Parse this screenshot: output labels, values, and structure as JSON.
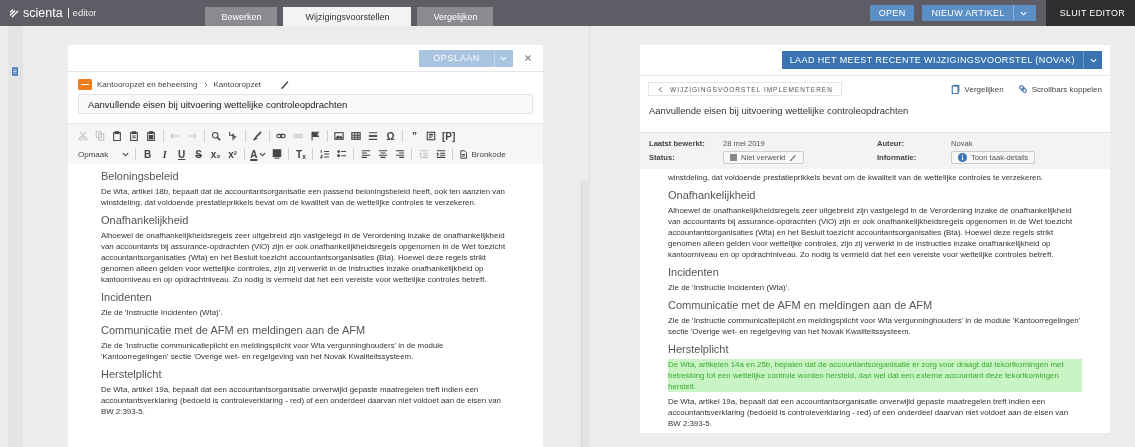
{
  "app": {
    "logo": "scienta",
    "product": "editor"
  },
  "tabs": [
    {
      "label": "Bewerken",
      "selected": false
    },
    {
      "label": "Wijzigingsvoorstellen",
      "selected": true
    },
    {
      "label": "Vergelijken",
      "selected": false
    }
  ],
  "top_actions": {
    "open": "OPEN",
    "new_article": "NIEUW ARTIKEL",
    "close_editor": "SLUIT EDITOR"
  },
  "editor": {
    "save": "OPSLAAN",
    "breadcrumb": [
      "Kantooropzet en beheersing",
      "Kantooropzet"
    ],
    "title": "Aanvullende eisen bij uitvoering wettelijke controleopdrachten",
    "toolbar": [
      [
        {
          "kind": "icon",
          "disabled": true
        },
        {
          "kind": "icon",
          "disabled": true
        },
        {
          "kind": "icon",
          "disabled": false
        },
        {
          "kind": "icon",
          "disabled": false
        },
        {
          "kind": "icon",
          "disabled": false
        },
        {
          "kind": "sep"
        },
        {
          "kind": "icon",
          "disabled": true
        },
        {
          "kind": "icon",
          "disabled": true
        },
        {
          "kind": "sep"
        },
        {
          "kind": "icon",
          "disabled": false
        },
        {
          "kind": "icon",
          "disabled": false
        },
        {
          "kind": "sep"
        },
        {
          "kind": "icon",
          "disabled": false
        },
        {
          "kind": "sep"
        },
        {
          "kind": "icon",
          "disabled": false
        },
        {
          "kind": "icon",
          "disabled": true
        },
        {
          "kind": "icon",
          "disabled": false
        },
        {
          "kind": "sep"
        },
        {
          "kind": "icon",
          "disabled": false
        },
        {
          "kind": "icon",
          "disabled": false
        },
        {
          "kind": "icon",
          "disabled": false
        },
        {
          "kind": "glyph",
          "text": "Ω",
          "disabled": false
        },
        {
          "kind": "sep"
        },
        {
          "kind": "glyph",
          "text": "”",
          "disabled": false
        },
        {
          "kind": "icon",
          "disabled": false
        },
        {
          "kind": "glyph",
          "text": "[P]",
          "disabled": false
        }
      ],
      [
        {
          "kind": "dropdown",
          "text": "Opmaak"
        },
        {
          "kind": "sep"
        },
        {
          "kind": "bold",
          "text": "B"
        },
        {
          "kind": "italic",
          "text": "I"
        },
        {
          "kind": "underline",
          "text": "U"
        },
        {
          "kind": "strike",
          "text": "S"
        },
        {
          "kind": "glyph",
          "text": "x₂",
          "disabled": false
        },
        {
          "kind": "glyph",
          "text": "x²",
          "disabled": false
        },
        {
          "kind": "sep"
        },
        {
          "kind": "color",
          "text": "A"
        },
        {
          "kind": "icon",
          "disabled": false
        },
        {
          "kind": "sep"
        },
        {
          "kind": "glyph",
          "text": "Tₓ",
          "disabled": false
        },
        {
          "kind": "sep"
        },
        {
          "kind": "icon",
          "disabled": false
        },
        {
          "kind": "icon",
          "disabled": false
        },
        {
          "kind": "sep"
        },
        {
          "kind": "icon",
          "disabled": false
        },
        {
          "kind": "icon",
          "disabled": false
        },
        {
          "kind": "icon",
          "disabled": false
        },
        {
          "kind": "sep"
        },
        {
          "kind": "icon",
          "disabled": true
        },
        {
          "kind": "icon",
          "disabled": false
        },
        {
          "kind": "sep"
        },
        {
          "kind": "source",
          "text": "Bronkode"
        }
      ]
    ],
    "content": [
      {
        "kind": "heading",
        "text": "Beloningsbeleid"
      },
      {
        "kind": "paragraph",
        "text": "De Wta, artikel 18b, bepaalt dat de accountantsorganisatie een passend beloningsbeleid heeft, ook ten aanzien van winstdeling, dat voldoende prestatieprikkels bevat om de kwaliteit van de wettelijke controles te verzekeren."
      },
      {
        "kind": "heading",
        "text": "Onafhankelijkheid"
      },
      {
        "kind": "paragraph",
        "text": "Alhoewel de onafhankelijkheidsregels zeer uitgebreid zijn vastgelegd in de Verordening inzake de onafhankelijkheid van accountants bij assurance-opdrachten (ViO) zijn er ook onafhankelijkheidsregels opgenomen in de Wet toezicht accountantsorganisaties (Wta) en het Besluit toezicht accountantsorganisaties (Bta). Hoewel deze regels strikt genomen alleen gelden voor wettelijke controles, zijn zij verwerkt in de instructies inzake onafhankelijkheid op kantoorniveau en op opdrachtniveau. Zo nodig is vermeld dat het een vereiste voor wettelijke controles betreft."
      },
      {
        "kind": "heading",
        "text": "Incidenten"
      },
      {
        "kind": "paragraph",
        "text": "Zie de 'Instructie Incidenten (Wta)'."
      },
      {
        "kind": "heading",
        "text": "Communicatie met de AFM en meldingen aan de AFM"
      },
      {
        "kind": "paragraph",
        "text": "Zie de 'Instructie communicatieplicht en meldingsplicht voor Wta vergunninghouders' in de module 'Kantoorregelingen' sectie 'Overige wet- en regelgeving van het Novak Kwaliteitssysteem."
      },
      {
        "kind": "heading",
        "text": "Herstelplicht"
      },
      {
        "kind": "paragraph",
        "text": "De Wta, artikel 19a, bepaalt dat een accountantsorganisatie onverwijld gepaste maatregelen treft indien een accountantsverklaring (bedoeld is controleverklaring - red) of een onderdeel daarvan niet voldoet aan de eisen van BW 2:393-5."
      }
    ]
  },
  "proposal": {
    "load": "LAAD HET MEEST RECENTE WIJZIGINGSVOORSTEL (NOVAK)",
    "back": "WIJZIGINGSVOORSTEL IMPLEMENTEREN",
    "links": [
      "Vergelijken",
      "Scrollbars koppelen"
    ],
    "title": "Aanvullende eisen bij uitvoering wettelijke controleopdrachten",
    "meta": {
      "last_edited_label": "Laatst bewerkt:",
      "last_edited": "28 mei 2019",
      "author_label": "Auteur:",
      "author": "Novak",
      "status_label": "Status:",
      "status": "Niet verwerkt",
      "info_label": "Informatie:",
      "info_button": "Toon taak-details"
    },
    "content": [
      {
        "kind": "paragraph",
        "text": "winstdeling, dat voldoende prestatieprikkels bevat om de kwaliteit van de wettelijke controles te verzekeren."
      },
      {
        "kind": "heading",
        "text": "Onafhankelijkheid"
      },
      {
        "kind": "paragraph",
        "text": "Alhoewel de onafhankelijkheidsregels zeer uitgebreid zijn vastgelegd in de Verordening inzake de onafhankelijkheid van accountants bij assurance-opdrachten (ViO) zijn er ook onafhankelijkheidsregels opgenomen in de Wet toezicht accountantsorganisaties (Wta) en het Besluit toezicht accountantsorganisaties (Bta). Hoewel deze regels strikt genomen alleen gelden voor wettelijke controles, zijn zij verwerkt in de instructies inzake onafhankelijkheid op kantoorniveau en op opdrachtniveau. Zo nodig is vermeld dat het een vereiste voor wettelijke controles betreft."
      },
      {
        "kind": "heading",
        "text": "Incidenten"
      },
      {
        "kind": "paragraph",
        "text": "Zie de 'Instructie Incidenten (Wta)'."
      },
      {
        "kind": "heading",
        "text": "Communicatie met de AFM en meldingen aan de AFM"
      },
      {
        "kind": "paragraph",
        "text": "Zie de 'Instructie communicatieplicht en meldingsplicht voor Wta vergunninghouders' in de module 'Kantoorregelingen' sectie 'Overige wet- en regelgeving van het Novak Kwaliteitssysteem."
      },
      {
        "kind": "heading",
        "text": "Herstelplicht"
      },
      {
        "kind": "inserted",
        "text": "De Wta, artikelen 14a en 25b, bepalen dat de accountantsorganisatie er zorg voor draagt dat tekortkomingen met betrekking tot een wettelijke controle worden hersteld, dan wel dat een externe accountant deze tekortkomingen herstelt."
      },
      {
        "kind": "paragraph",
        "text": "De Wta, artikel 19a, bepaalt dat een accountantsorganisatie onverwijld gepaste maatregelen treft indien een accountantsverklaring (bedoeld is controleverklaring - red) of een onderdeel daarvan niet voldoet aan de eisen van BW 2:393-5."
      }
    ]
  }
}
